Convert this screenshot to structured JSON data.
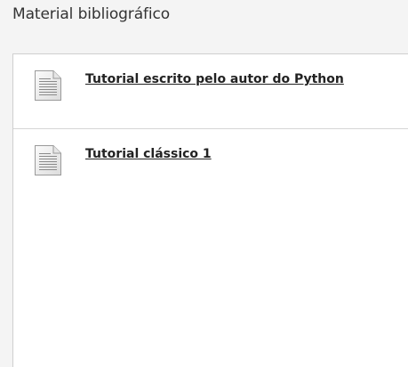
{
  "header": {
    "title": "Material bibliográfico"
  },
  "content": {
    "items": [
      {
        "label": "Tutorial escrito pelo autor do Python",
        "icon": "document-icon"
      },
      {
        "label": "Tutorial clássico 1",
        "icon": "document-icon"
      }
    ]
  }
}
